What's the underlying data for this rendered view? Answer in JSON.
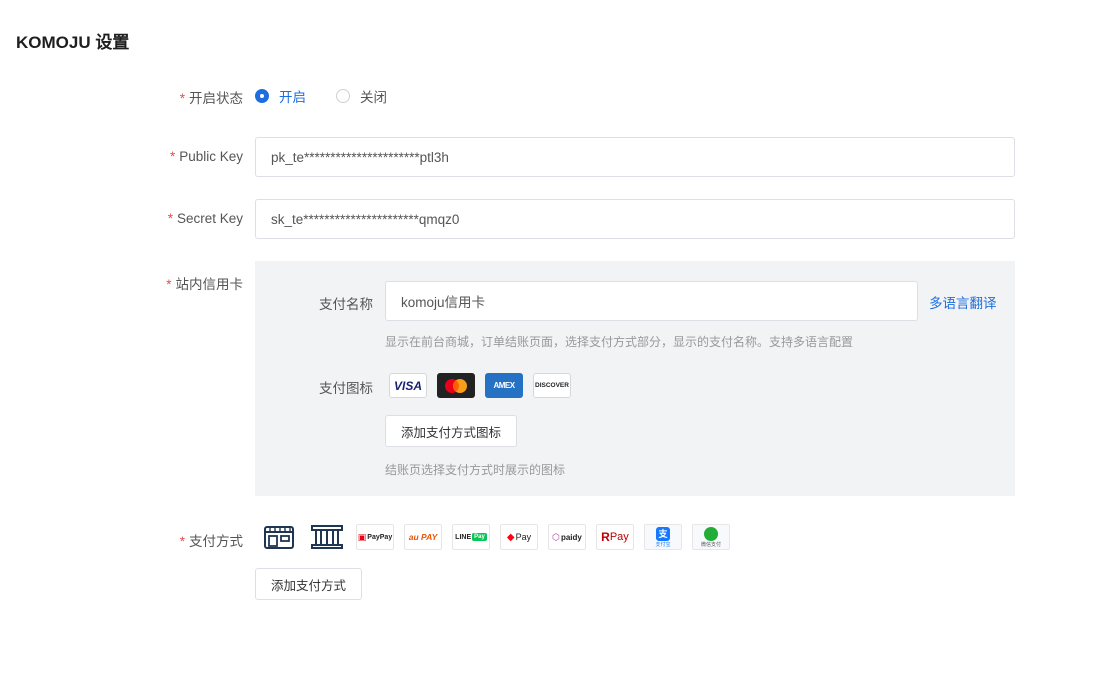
{
  "page": {
    "title": "KOMOJU 设置"
  },
  "form": {
    "status": {
      "label": "开启状态",
      "options": [
        {
          "label": "开启",
          "checked": true
        },
        {
          "label": "关闭",
          "checked": false
        }
      ]
    },
    "public_key": {
      "label": "Public Key",
      "value": "pk_te**********************ptl3h"
    },
    "secret_key": {
      "label": "Secret Key",
      "value": "sk_te**********************qmqz0"
    },
    "credit_card": {
      "label": "站内信用卡",
      "pay_name_label": "支付名称",
      "pay_name_value": "komoju信用卡",
      "translate_link": "多语言翻译",
      "pay_name_hint": "显示在前台商城，订单结账页面，选择支付方式部分，显示的支付名称。支持多语言配置",
      "pay_icon_label": "支付图标",
      "card_icons": [
        "visa-icon",
        "mastercard-icon",
        "amex-icon",
        "discover-icon"
      ],
      "add_icon_button": "添加支付方式图标",
      "icon_hint": "结账页选择支付方式时展示的图标"
    },
    "payment_methods": {
      "label": "支付方式",
      "icons": [
        "konbini-icon",
        "bank-transfer-icon",
        "paypay-icon",
        "au-pay-icon",
        "line-pay-icon",
        "merpay-icon",
        "paidy-icon",
        "rakuten-pay-icon",
        "alipay-icon",
        "wechat-pay-icon"
      ],
      "icon_text": {
        "paypay": "PayPay",
        "aupay": "au PAY",
        "linepay_a": "LINE",
        "linepay_b": "Pay",
        "merpay": "Pay",
        "paidy": "paidy",
        "rpay_r": "R",
        "rpay": "Pay",
        "alipay": "支付宝",
        "wechat": "微信支付"
      },
      "add_button": "添加支付方式"
    },
    "card_text": {
      "visa": "VISA",
      "amex": "AMEX",
      "discover": "DISCOVER"
    },
    "required_mark": "*"
  },
  "colors": {
    "accent": "#1d6fe0",
    "required": "#e34d4d",
    "panel_bg": "#f2f3f5"
  }
}
